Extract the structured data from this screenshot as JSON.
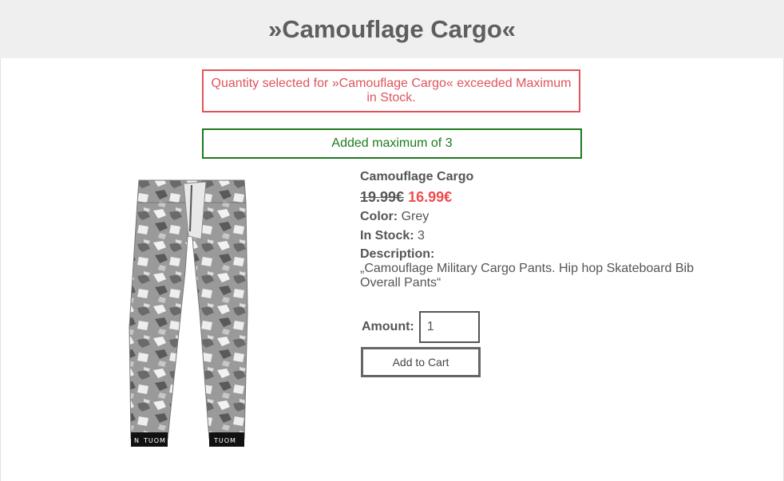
{
  "header": {
    "title": "»Camouflage Cargo«"
  },
  "alerts": {
    "error": "Quantity selected for »Camouflage Cargo« exceeded Maximum in Stock.",
    "success": "Added maximum of 3"
  },
  "product": {
    "name": "Camouflage Cargo",
    "old_price": "19.99€",
    "new_price": "16.99€",
    "color_label": "Color:",
    "color_value": "Grey",
    "stock_label": "In Stock:",
    "stock_value": "3",
    "description_label": "Description:",
    "description": "„Camouflage Military Cargo Pants. Hip hop Skateboard Bib Overall Pants“",
    "image_icon": "camouflage-pants-image",
    "cuff_text": "TUOM"
  },
  "form": {
    "amount_label": "Amount:",
    "amount_value": "1",
    "add_to_cart_label": "Add to Cart"
  },
  "colors": {
    "error": "#e0545c",
    "success": "#1e7a1e",
    "sale_price": "#ef4c4c",
    "header_bg": "#efefef"
  }
}
